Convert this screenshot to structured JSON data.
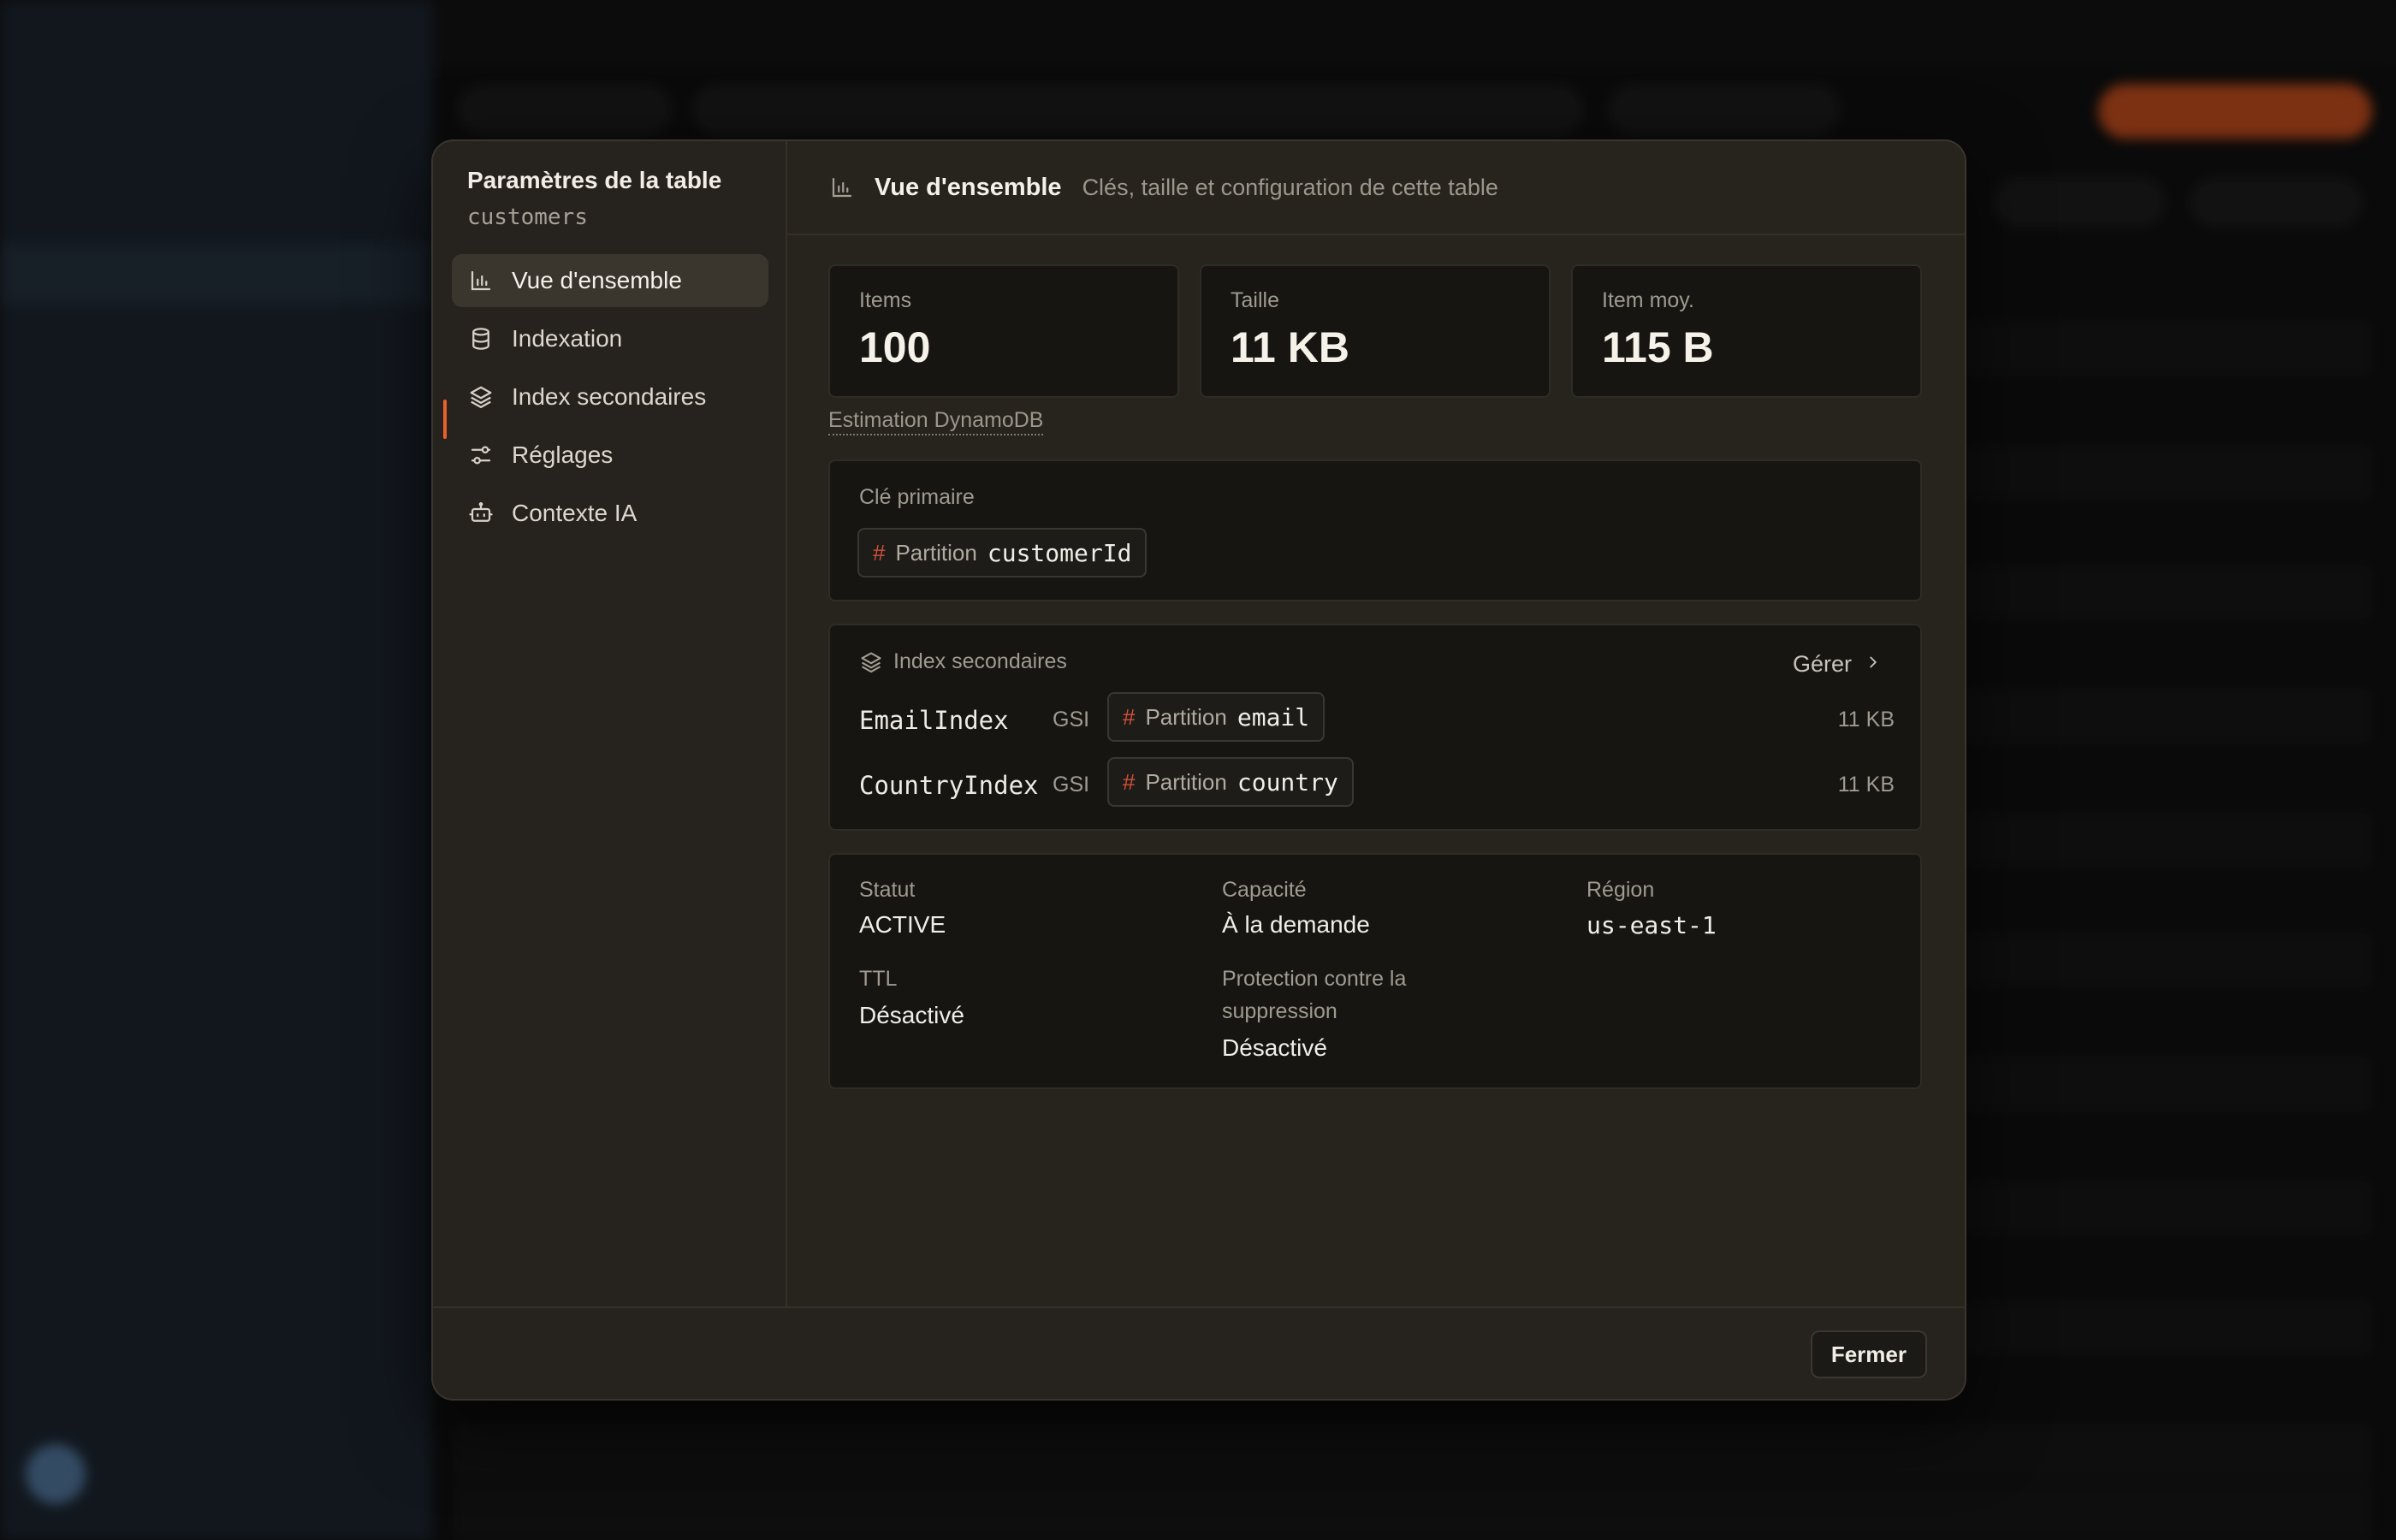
{
  "modal": {
    "sidebar_title": "Paramètres de la table",
    "table_name": "customers",
    "nav": [
      {
        "label": "Vue d'ensemble",
        "icon": "bar-chart-icon"
      },
      {
        "label": "Indexation",
        "icon": "database-icon"
      },
      {
        "label": "Index secondaires",
        "icon": "layers-icon"
      },
      {
        "label": "Réglages",
        "icon": "sliders-icon"
      },
      {
        "label": "Contexte IA",
        "icon": "bot-icon"
      }
    ],
    "header": {
      "title": "Vue d'ensemble",
      "subtitle": "Clés, taille et configuration de cette table"
    },
    "stats": [
      {
        "label": "Items",
        "value": "100"
      },
      {
        "label": "Taille",
        "value": "11 KB"
      },
      {
        "label": "Item moy.",
        "value": "115 B"
      }
    ],
    "estimate_label": "Estimation DynamoDB",
    "primary_key": {
      "label": "Clé primaire",
      "kind": "Partition",
      "attribute": "customerId"
    },
    "secondary_indexes": {
      "label": "Index secondaires",
      "manage_label": "Gérer",
      "items": [
        {
          "name": "EmailIndex",
          "type": "GSI",
          "kind": "Partition",
          "attribute": "email",
          "size": "11 KB"
        },
        {
          "name": "CountryIndex",
          "type": "GSI",
          "kind": "Partition",
          "attribute": "country",
          "size": "11 KB"
        }
      ]
    },
    "config": {
      "status_label": "Statut",
      "status_value": "ACTIVE",
      "capacity_label": "Capacité",
      "capacity_value": "À la demande",
      "region_label": "Région",
      "region_value": "us-east-1",
      "ttl_label": "TTL",
      "ttl_value": "Désactivé",
      "deletion_label": "Protection contre la suppression",
      "deletion_value": "Désactivé"
    },
    "close_label": "Fermer"
  },
  "colors": {
    "accent": "#e8612a",
    "key_hash": "#d2503a"
  }
}
